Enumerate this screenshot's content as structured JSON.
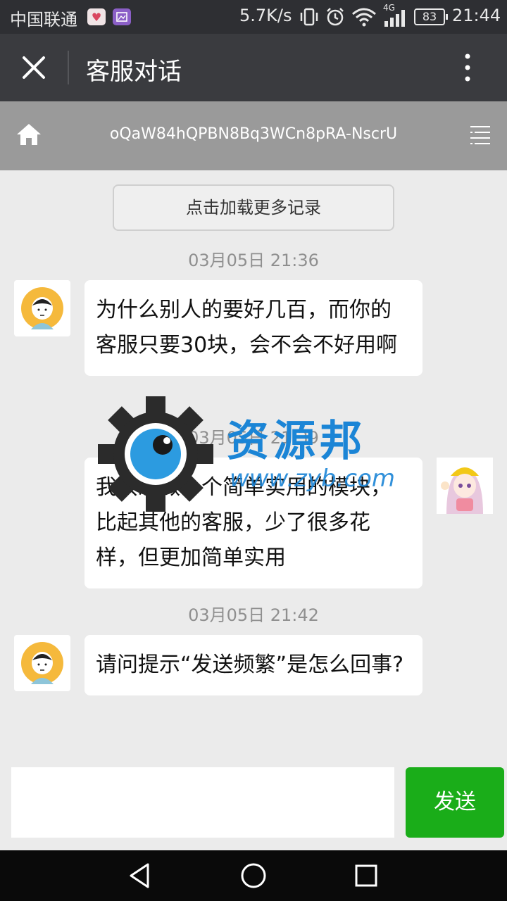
{
  "status_bar": {
    "carrier": "中国联通",
    "net_speed": "5.7K/s",
    "network_type": "4G",
    "battery": "83",
    "time": "21:44"
  },
  "header": {
    "title": "客服对话",
    "close_icon": "close-icon",
    "more_icon": "more-vertical-icon"
  },
  "sub_header": {
    "session_id": "oQaW84hQPBN8Bq3WCn8pRA-NscrU",
    "home_icon": "home-icon",
    "menu_icon": "menu-icon"
  },
  "chat": {
    "load_more_label": "点击加载更多记录",
    "messages": [
      {
        "timestamp": "03月05日 21:36",
        "side": "left",
        "text": "为什么别人的要好几百，而你的客服只要30块，会不会不好用啊"
      },
      {
        "timestamp": "03月05日 21:39",
        "side": "right",
        "text": "我只想做一个简单实用的模块，比起其他的客服，少了很多花样，但更加简单实用"
      },
      {
        "timestamp": "03月05日 21:42",
        "side": "left",
        "text": "请问提示“发送频繁”是怎么回事?"
      }
    ]
  },
  "watermark": {
    "text": "资源邦",
    "sub": "www.zyb.com"
  },
  "composer": {
    "input_value": "",
    "send_label": "发送"
  },
  "colors": {
    "send_button": "#1aad19",
    "title_bar": "#3a3b3f",
    "sub_header": "#9a9a9a"
  }
}
